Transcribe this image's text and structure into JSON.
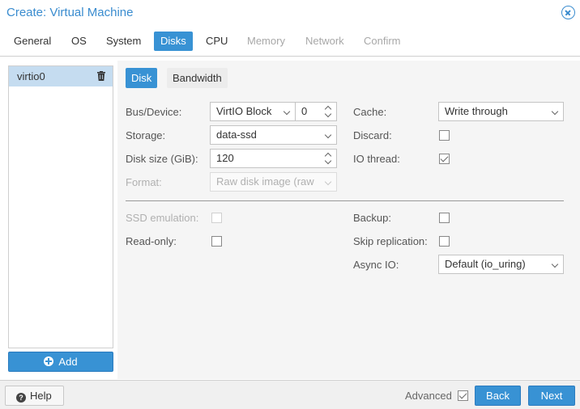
{
  "window": {
    "title": "Create: Virtual Machine"
  },
  "tabs": [
    {
      "label": "General",
      "state": "normal"
    },
    {
      "label": "OS",
      "state": "normal"
    },
    {
      "label": "System",
      "state": "normal"
    },
    {
      "label": "Disks",
      "state": "active"
    },
    {
      "label": "CPU",
      "state": "normal"
    },
    {
      "label": "Memory",
      "state": "disabled"
    },
    {
      "label": "Network",
      "state": "disabled"
    },
    {
      "label": "Confirm",
      "state": "disabled"
    }
  ],
  "disk_list": {
    "items": [
      {
        "label": "virtio0"
      }
    ],
    "add_label": "Add"
  },
  "subtabs": [
    {
      "label": "Disk",
      "state": "active"
    },
    {
      "label": "Bandwidth",
      "state": "normal"
    }
  ],
  "form": {
    "bus_device": {
      "label": "Bus/Device:",
      "bus": "VirtIO Block",
      "device": "0"
    },
    "storage": {
      "label": "Storage:",
      "value": "data-ssd"
    },
    "disk_size": {
      "label": "Disk size (GiB):",
      "value": "120"
    },
    "format": {
      "label": "Format:",
      "value": "Raw disk image (raw"
    },
    "cache": {
      "label": "Cache:",
      "value": "Write through"
    },
    "discard": {
      "label": "Discard:",
      "checked": false
    },
    "io_thread": {
      "label": "IO thread:",
      "checked": true
    },
    "ssd_emulation": {
      "label": "SSD emulation:",
      "checked": false
    },
    "read_only": {
      "label": "Read-only:",
      "checked": false
    },
    "backup": {
      "label": "Backup:",
      "checked": false
    },
    "skip_replication": {
      "label": "Skip replication:",
      "checked": false
    },
    "async_io": {
      "label": "Async IO:",
      "value": "Default (io_uring)"
    }
  },
  "footer": {
    "help_label": "Help",
    "advanced_label": "Advanced",
    "advanced_checked": true,
    "back_label": "Back",
    "next_label": "Next"
  },
  "colors": {
    "accent": "#3892d4",
    "title": "#3a8ccf",
    "selection": "#c5dcf0"
  }
}
